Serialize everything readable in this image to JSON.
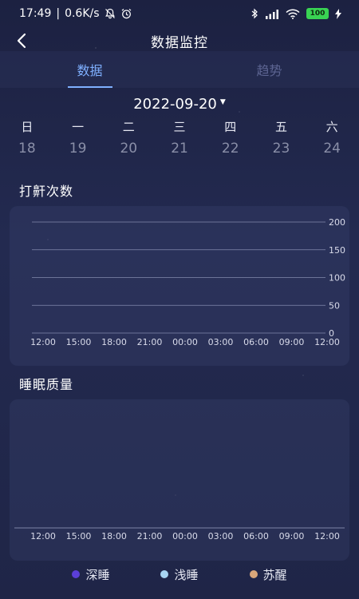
{
  "status": {
    "time": "17:49",
    "speed": "0.6K/s",
    "battery": "100"
  },
  "header": {
    "title": "数据监控"
  },
  "tabs": [
    {
      "label": "数据",
      "active": true
    },
    {
      "label": "趋势",
      "active": false
    }
  ],
  "date": {
    "value": "2022-09-20"
  },
  "week": {
    "days": [
      "日",
      "一",
      "二",
      "三",
      "四",
      "五",
      "六"
    ],
    "dates": [
      "18",
      "19",
      "20",
      "21",
      "22",
      "23",
      "24"
    ]
  },
  "sections": {
    "snore": "打鼾次数",
    "sleep": "睡眠质量"
  },
  "legend": [
    {
      "label": "深睡",
      "color": "#5b3fd9"
    },
    {
      "label": "浅睡",
      "color": "#a7d4f2"
    },
    {
      "label": "苏醒",
      "color": "#d9a77a"
    }
  ],
  "chart_data": [
    {
      "type": "line",
      "title": "",
      "x": [
        "12:00",
        "15:00",
        "18:00",
        "21:00",
        "00:00",
        "03:00",
        "06:00",
        "09:00",
        "12:00"
      ],
      "series": [],
      "ylim": [
        0,
        200
      ],
      "yticks": [
        0,
        50,
        100,
        150,
        200
      ],
      "y_axis_side": "right",
      "grid": true
    },
    {
      "type": "bar",
      "title": "",
      "x": [
        "12:00",
        "15:00",
        "18:00",
        "21:00",
        "00:00",
        "03:00",
        "06:00",
        "09:00",
        "12:00"
      ],
      "series": [],
      "grid": false
    }
  ]
}
